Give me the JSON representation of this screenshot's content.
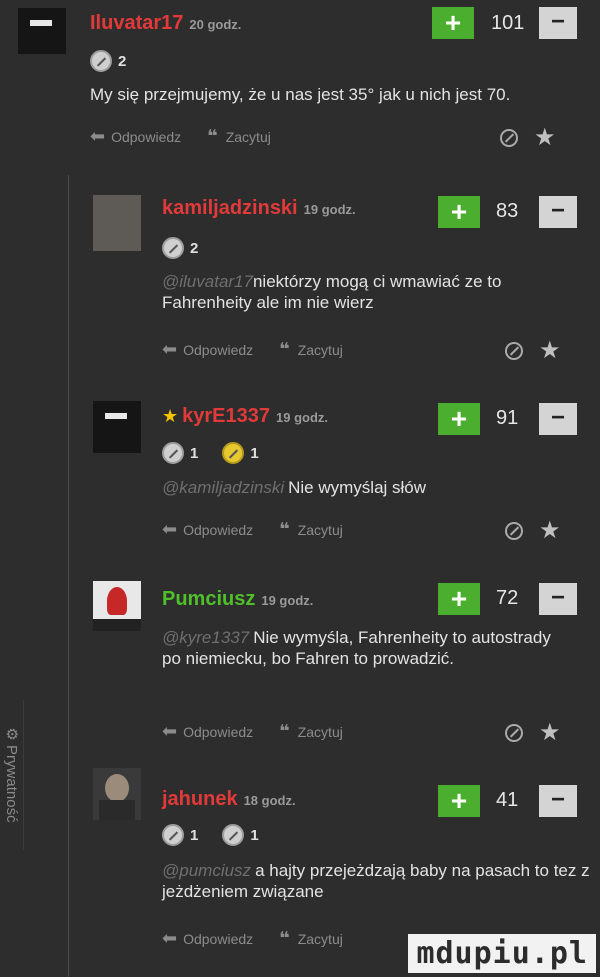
{
  "side_tab": {
    "label": "Prywatność",
    "icon": "gear-icon"
  },
  "comments": [
    {
      "username": "Iluvatar17",
      "time": "20 godz.",
      "votes": "101",
      "badge1": "2",
      "badge2": "",
      "mention": "",
      "text": "My się przejmujemy, że u nas jest 35° jak u nich jest 70.",
      "reply_label": "Odpowiedz",
      "quote_label": "Zacytuj"
    },
    {
      "username": "kamiljadzinski",
      "time": "19 godz.",
      "votes": "83",
      "badge1": "2",
      "badge2": "",
      "mention": "@iluvatar17",
      "text": "niektórzy mogą ci wmawiać ze to Fahrenheity ale im nie wierz",
      "reply_label": "Odpowiedz",
      "quote_label": "Zacytuj"
    },
    {
      "username": "kyrE1337",
      "time": "19 godz.",
      "votes": "91",
      "badge1": "1",
      "badge2": "1",
      "mention": "@kamiljadzinski",
      "text": "Nie wymyślaj słów",
      "reply_label": "Odpowiedz",
      "quote_label": "Zacytuj"
    },
    {
      "username": "Pumciusz",
      "time": "19 godz.",
      "votes": "72",
      "badge1": "",
      "badge2": "",
      "mention": "@kyre1337",
      "text": "Nie wymyśla, Fahrenheity to autostrady po niemiecku, bo Fahren to prowadzić.",
      "reply_label": "Odpowiedz",
      "quote_label": "Zacytuj"
    },
    {
      "username": "jahunek",
      "time": "18 godz.",
      "votes": "41",
      "badge1": "1",
      "badge2": "1",
      "mention": "@pumciusz",
      "text": "a hajty przejeżdzają baby na pasach to tez z jeżdżeniem związane",
      "reply_label": "Odpowiedz",
      "quote_label": "Zacytuj"
    }
  ],
  "vote_plus_symbol": "+",
  "vote_minus_symbol": "−",
  "watermark": "mdupiu.pl",
  "colors": {
    "username": "#e23a3a",
    "plus": "#4cae2e",
    "background": "#2d2d2d"
  }
}
